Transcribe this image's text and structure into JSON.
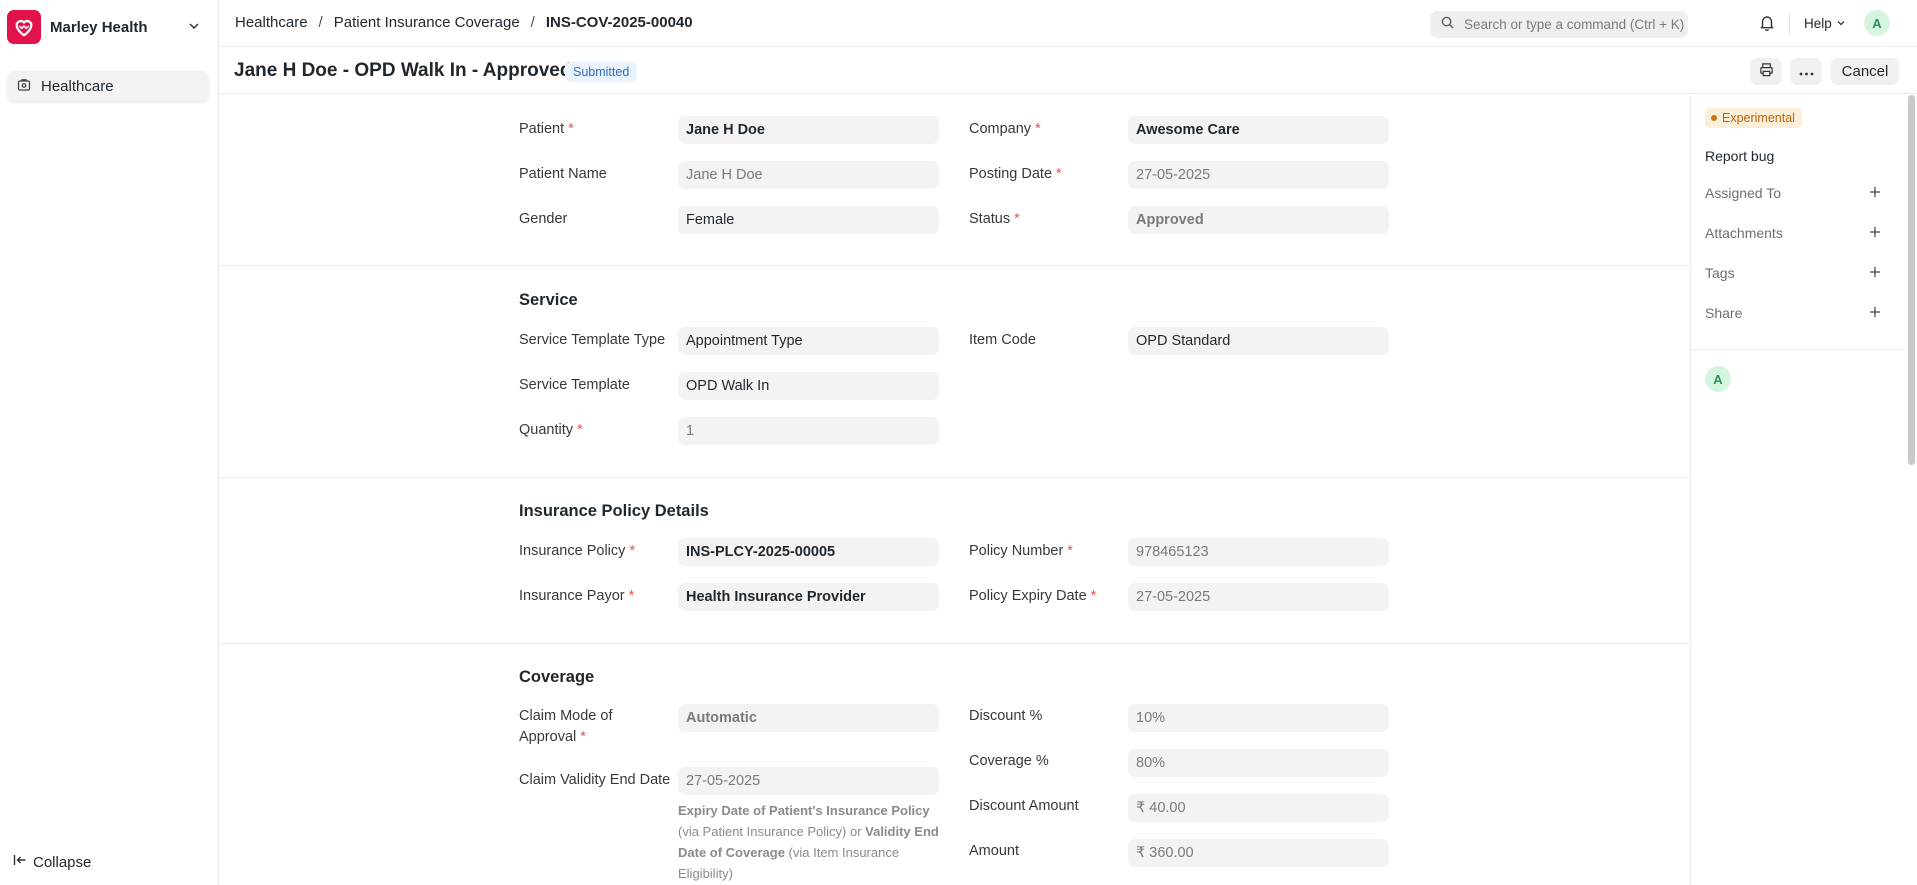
{
  "sidebar": {
    "brand_name": "Marley Health",
    "brand_color": "#e2124d",
    "items": [
      {
        "label": "Healthcare",
        "icon": "healthcare-icon"
      }
    ],
    "collapse_label": "Collapse"
  },
  "topbar": {
    "breadcrumbs": [
      "Healthcare",
      "Patient Insurance Coverage",
      "INS-COV-2025-00040"
    ],
    "search_placeholder": "Search or type a command (Ctrl + K)",
    "help_label": "Help",
    "avatar_initial": "A"
  },
  "header": {
    "title": "Jane H Doe - OPD Walk In - Approved",
    "status": "Submitted",
    "cancel_label": "Cancel"
  },
  "form": {
    "top": {
      "patient": {
        "label": "Patient",
        "value": "Jane H Doe"
      },
      "patient_name": {
        "label": "Patient Name",
        "value": "Jane H Doe"
      },
      "gender": {
        "label": "Gender",
        "value": "Female"
      },
      "company": {
        "label": "Company",
        "value": "Awesome Care"
      },
      "posting_date": {
        "label": "Posting Date",
        "value": "27-05-2025"
      },
      "status": {
        "label": "Status",
        "value": "Approved"
      }
    },
    "service": {
      "title": "Service",
      "template_type": {
        "label": "Service Template Type",
        "value": "Appointment Type"
      },
      "template": {
        "label": "Service Template",
        "value": "OPD Walk In"
      },
      "quantity": {
        "label": "Quantity",
        "value": "1"
      },
      "item_code": {
        "label": "Item Code",
        "value": "OPD Standard"
      }
    },
    "policy": {
      "title": "Insurance Policy Details",
      "insurance_policy": {
        "label": "Insurance Policy",
        "value": "INS-PLCY-2025-00005"
      },
      "insurance_payor": {
        "label": "Insurance Payor",
        "value": "Health Insurance Provider"
      },
      "policy_number": {
        "label": "Policy Number",
        "value": "978465123"
      },
      "policy_expiry": {
        "label": "Policy Expiry Date",
        "value": "27-05-2025"
      }
    },
    "coverage": {
      "title": "Coverage",
      "claim_mode_line1": "Claim Mode of",
      "claim_mode_line2": "Approval",
      "claim_mode_value": "Automatic",
      "claim_validity": {
        "label": "Claim Validity End Date",
        "value": "27-05-2025"
      },
      "help": {
        "b1": "Expiry Date of Patient's Insurance Policy",
        "t1": " (via Patient Insurance Policy) or ",
        "b2": "Validity End Date of Coverage",
        "t2": " (via Item Insurance Eligibility)"
      },
      "discount_pct": {
        "label": "Discount %",
        "value": "10%"
      },
      "coverage_pct": {
        "label": "Coverage %",
        "value": "80%"
      },
      "discount_amount": {
        "label": "Discount Amount",
        "value": "₹ 40.00"
      },
      "amount": {
        "label": "Amount",
        "value": "₹ 360.00"
      }
    }
  },
  "right_panel": {
    "badge": "Experimental",
    "report_bug": "Report bug",
    "rows": [
      "Assigned To",
      "Attachments",
      "Tags",
      "Share"
    ],
    "viewer_initial": "A"
  }
}
